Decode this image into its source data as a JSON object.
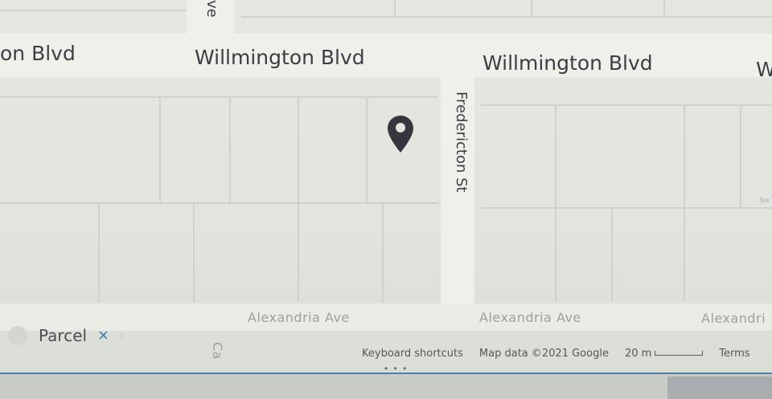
{
  "map": {
    "streets": {
      "willmington_left": "on Blvd",
      "willmington_center": "Willmington Blvd",
      "willmington_right": "Willmington Blvd",
      "willmington_far_right": "W",
      "fredericton": "Fredericton St",
      "top_avenue": "ve",
      "alexandria_1": "Alexandria Ave",
      "alexandria_2": "Alexandria Ave",
      "alexandria_3": "Alexandri",
      "corner_fragment": "Ca",
      "tiny_label": "Sre"
    },
    "marker": {
      "icon": "map-pin-icon",
      "color": "#34373d"
    }
  },
  "parcel_chip": {
    "label": "Parcel",
    "close_symbol": "×",
    "next_symbol": "›",
    "close_color": "#3a7bb4"
  },
  "attribution": {
    "keyboard_shortcuts": "Keyboard shortcuts",
    "map_data": "Map data ©2021 Google",
    "scale_text": "20 m",
    "terms": "Terms"
  },
  "bottom": {
    "dots": "• • •",
    "accent_color": "#4f7fa8"
  }
}
